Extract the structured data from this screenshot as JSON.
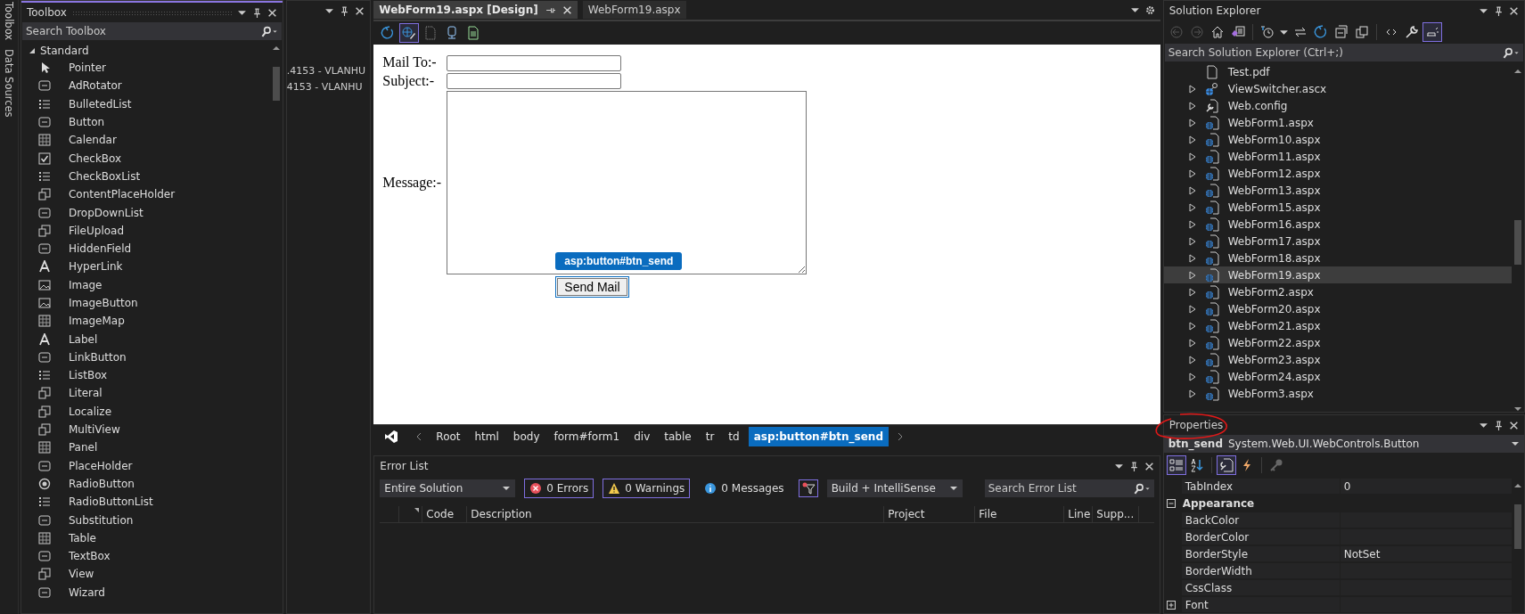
{
  "side_tabs": [
    "Toolbox",
    "Data Sources"
  ],
  "toolbox": {
    "title": "Toolbox",
    "search": {
      "placeholder": "Search Toolbox"
    },
    "group": {
      "label": "Standard",
      "expanded": true
    },
    "items": [
      {
        "label": "Pointer",
        "kind": "pointer"
      },
      {
        "label": "AdRotator",
        "kind": "control"
      },
      {
        "label": "BulletedList",
        "kind": "list"
      },
      {
        "label": "Button",
        "kind": "control"
      },
      {
        "label": "Calendar",
        "kind": "grid"
      },
      {
        "label": "CheckBox",
        "kind": "check"
      },
      {
        "label": "CheckBoxList",
        "kind": "list"
      },
      {
        "label": "ContentPlaceHolder",
        "kind": "page"
      },
      {
        "label": "DropDownList",
        "kind": "control"
      },
      {
        "label": "FileUpload",
        "kind": "page"
      },
      {
        "label": "HiddenField",
        "kind": "control"
      },
      {
        "label": "HyperLink",
        "kind": "letter"
      },
      {
        "label": "Image",
        "kind": "image"
      },
      {
        "label": "ImageButton",
        "kind": "image"
      },
      {
        "label": "ImageMap",
        "kind": "grid"
      },
      {
        "label": "Label",
        "kind": "letter"
      },
      {
        "label": "LinkButton",
        "kind": "control"
      },
      {
        "label": "ListBox",
        "kind": "list"
      },
      {
        "label": "Literal",
        "kind": "page"
      },
      {
        "label": "Localize",
        "kind": "page"
      },
      {
        "label": "MultiView",
        "kind": "page"
      },
      {
        "label": "Panel",
        "kind": "grid"
      },
      {
        "label": "PlaceHolder",
        "kind": "control"
      },
      {
        "label": "RadioButton",
        "kind": "radio"
      },
      {
        "label": "RadioButtonList",
        "kind": "list"
      },
      {
        "label": "Substitution",
        "kind": "control"
      },
      {
        "label": "Table",
        "kind": "grid"
      },
      {
        "label": "TextBox",
        "kind": "control"
      },
      {
        "label": "View",
        "kind": "page"
      },
      {
        "label": "Wizard",
        "kind": "control"
      }
    ]
  },
  "middle_panel": {
    "lines": [
      ".4153 - VLANHU",
      "4153 - VLANHU"
    ]
  },
  "editor": {
    "tabs": [
      {
        "label": "WebForm19.aspx [Design]",
        "selected": true
      },
      {
        "label": "WebForm19.aspx",
        "selected": false
      }
    ],
    "design": {
      "fields": [
        {
          "label": "Mail To:-",
          "kind": "input"
        },
        {
          "label": "Subject:-",
          "kind": "input"
        },
        {
          "label": "Message:-",
          "kind": "textarea"
        }
      ],
      "button": "Send Mail",
      "tag_tooltip": "asp:button#btn_send"
    },
    "breadcrumb": [
      {
        "label": "Root",
        "selected": false
      },
      {
        "label": "html",
        "selected": false
      },
      {
        "label": "body",
        "selected": false
      },
      {
        "label": "form#form1",
        "selected": false
      },
      {
        "label": "div",
        "selected": false
      },
      {
        "label": "table",
        "selected": false
      },
      {
        "label": "tr",
        "selected": false
      },
      {
        "label": "td",
        "selected": false
      },
      {
        "label": "asp:button#btn_send",
        "selected": true
      }
    ]
  },
  "error_list": {
    "title": "Error List",
    "scope": "Entire Solution",
    "errors": "0 Errors",
    "warnings": "0 Warnings",
    "messages": "0 Messages",
    "build_filter": "Build + IntelliSense",
    "search": {
      "placeholder": "Search Error List"
    },
    "columns": [
      "Code",
      "Description",
      "Project",
      "File",
      "Line",
      "Supp..."
    ]
  },
  "solution_explorer": {
    "title": "Solution Explorer",
    "search": {
      "placeholder": "Search Solution Explorer (Ctrl+;)"
    },
    "items": [
      {
        "label": "Test.pdf",
        "kind": "file",
        "expandable": false,
        "selected": false
      },
      {
        "label": "ViewSwitcher.ascx",
        "kind": "control",
        "expandable": true,
        "selected": false
      },
      {
        "label": "Web.config",
        "kind": "config",
        "expandable": true,
        "selected": false
      },
      {
        "label": "WebForm1.aspx",
        "kind": "page",
        "expandable": true,
        "selected": false
      },
      {
        "label": "WebForm10.aspx",
        "kind": "page",
        "expandable": true,
        "selected": false
      },
      {
        "label": "WebForm11.aspx",
        "kind": "page",
        "expandable": true,
        "selected": false
      },
      {
        "label": "WebForm12.aspx",
        "kind": "page",
        "expandable": true,
        "selected": false
      },
      {
        "label": "WebForm13.aspx",
        "kind": "page",
        "expandable": true,
        "selected": false
      },
      {
        "label": "WebForm15.aspx",
        "kind": "page",
        "expandable": true,
        "selected": false
      },
      {
        "label": "WebForm16.aspx",
        "kind": "page",
        "expandable": true,
        "selected": false
      },
      {
        "label": "WebForm17.aspx",
        "kind": "page",
        "expandable": true,
        "selected": false
      },
      {
        "label": "WebForm18.aspx",
        "kind": "page",
        "expandable": true,
        "selected": false
      },
      {
        "label": "WebForm19.aspx",
        "kind": "page",
        "expandable": true,
        "selected": true
      },
      {
        "label": "WebForm2.aspx",
        "kind": "page",
        "expandable": true,
        "selected": false
      },
      {
        "label": "WebForm20.aspx",
        "kind": "page",
        "expandable": true,
        "selected": false
      },
      {
        "label": "WebForm21.aspx",
        "kind": "page",
        "expandable": true,
        "selected": false
      },
      {
        "label": "WebForm22.aspx",
        "kind": "page",
        "expandable": true,
        "selected": false
      },
      {
        "label": "WebForm23.aspx",
        "kind": "page",
        "expandable": true,
        "selected": false
      },
      {
        "label": "WebForm24.aspx",
        "kind": "page",
        "expandable": true,
        "selected": false
      },
      {
        "label": "WebForm3.aspx",
        "kind": "page",
        "expandable": true,
        "selected": false
      }
    ]
  },
  "properties": {
    "title": "Properties",
    "object_name": "btn_send",
    "object_type": "System.Web.UI.WebControls.Button",
    "rows": [
      {
        "kind": "property",
        "name": "TabIndex",
        "value": "0"
      },
      {
        "kind": "category",
        "name": "Appearance",
        "expanded": true
      },
      {
        "kind": "property",
        "name": "BackColor"
      },
      {
        "kind": "property",
        "name": "BorderColor"
      },
      {
        "kind": "property",
        "name": "BorderStyle",
        "value": "NotSet"
      },
      {
        "kind": "property",
        "name": "BorderWidth"
      },
      {
        "kind": "property",
        "name": "CssClass"
      },
      {
        "kind": "expandable",
        "name": "Font",
        "expanded": false
      }
    ]
  }
}
